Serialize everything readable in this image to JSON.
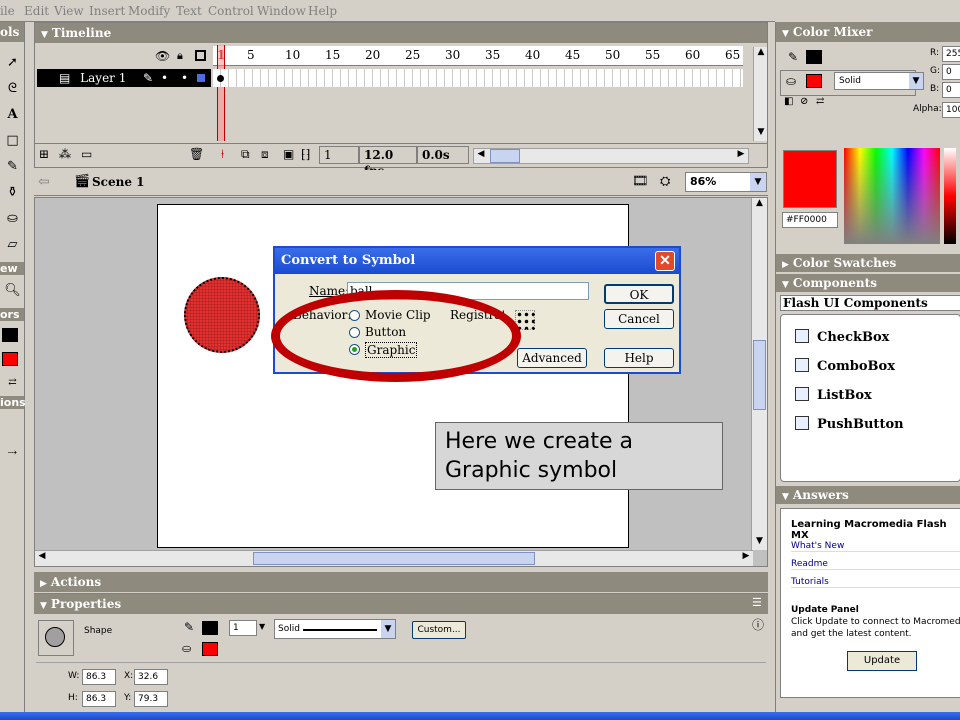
{
  "menu": [
    "ile",
    "Edit",
    "View",
    "Insert",
    "Modify",
    "Text",
    "Control",
    "Window",
    "Help"
  ],
  "tools_panel": {
    "title": "ols",
    "sections": {
      "view": "ew",
      "colors": "ors",
      "options": "ions"
    }
  },
  "timeline": {
    "title": "Timeline",
    "layer_name": "Layer 1",
    "frame_numbers": [
      "1",
      "5",
      "10",
      "15",
      "20",
      "25",
      "30",
      "35",
      "40",
      "45",
      "50",
      "55",
      "60",
      "65"
    ],
    "current_frame": "1",
    "fps": "12.0 fps",
    "elapsed": "0.0s"
  },
  "scene": {
    "name": "Scene 1",
    "zoom": "86%"
  },
  "dialog": {
    "title": "Convert to Symbol",
    "name_label": "Name:",
    "name_value": "ball",
    "behavior_label": "Behavior:",
    "behaviors": [
      "Movie Clip",
      "Button",
      "Graphic"
    ],
    "selected_behavior": "Graphic",
    "registration_label": "Registration:",
    "ok": "OK",
    "cancel": "Cancel",
    "advanced": "Advanced",
    "help": "Help"
  },
  "callout": {
    "line1": "Here we create a",
    "line2": "Graphic symbol"
  },
  "color_mixer": {
    "title": "Color Mixer",
    "fill_style": "Solid",
    "r_label": "R:",
    "r": "255",
    "g_label": "G:",
    "g": "0",
    "b_label": "B:",
    "b": "0",
    "alpha_label": "Alpha:",
    "alpha": "100%",
    "hex": "#FF0000",
    "fill_color": "#ff0000"
  },
  "color_swatches": {
    "title": "Color Swatches"
  },
  "components": {
    "title": "Components",
    "set": "Flash UI Components",
    "items": [
      "CheckBox",
      "ComboBox",
      "ListBox",
      "PushButton"
    ]
  },
  "answers": {
    "title": "Answers",
    "heading": "Learning Macromedia Flash MX",
    "links": [
      "What's New",
      "Readme",
      "Tutorials"
    ],
    "update_heading": "Update Panel",
    "update_text1": "Click Update to connect to Macromedia.com",
    "update_text2": "and get the latest content.",
    "update_button": "Update"
  },
  "actions_panel": {
    "title": "Actions"
  },
  "properties": {
    "title": "Properties",
    "type": "Shape",
    "stroke_height": "1",
    "stroke_style": "Solid",
    "custom_button": "Custom...",
    "w_label": "W:",
    "w": "86.3",
    "h_label": "H:",
    "h": "86.3",
    "x_label": "X:",
    "x": "32.6",
    "y_label": "Y:",
    "y": "79.3"
  }
}
